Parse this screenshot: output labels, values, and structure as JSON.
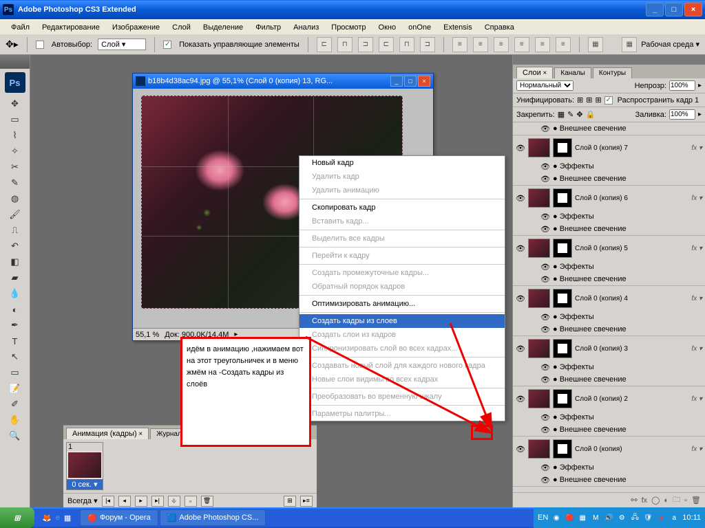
{
  "app": {
    "title": "Adobe Photoshop CS3 Extended"
  },
  "menu": [
    "Файл",
    "Редактирование",
    "Изображение",
    "Слой",
    "Выделение",
    "Фильтр",
    "Анализ",
    "Просмотр",
    "Окно",
    "onOne",
    "Extensis",
    "Справка"
  ],
  "options": {
    "autoselect": "Автовыбор:",
    "autoselect_val": "Слой",
    "show_controls": "Показать управляющие элементы",
    "workspace_label": "Рабочая среда"
  },
  "doc": {
    "title": "b18b4d38ac94.jpg @ 55,1% (Слой 0 (копия) 13, RG...",
    "zoom": "55,1 %",
    "status": "Док: 900,0K/14,4M"
  },
  "context_menu": [
    {
      "t": "Новый кадр",
      "d": false
    },
    {
      "t": "Удалить кадр",
      "d": true
    },
    {
      "t": "Удалить анимацию",
      "d": true
    },
    {
      "sep": true
    },
    {
      "t": "Скопировать кадр",
      "d": false
    },
    {
      "t": "Вставить кадр...",
      "d": true
    },
    {
      "sep": true
    },
    {
      "t": "Выделить все кадры",
      "d": true
    },
    {
      "sep": true
    },
    {
      "t": "Перейти к кадру",
      "d": true
    },
    {
      "sep": true
    },
    {
      "t": "Создать промежуточные кадры...",
      "d": true
    },
    {
      "t": "Обратный порядок кадров",
      "d": true
    },
    {
      "sep": true
    },
    {
      "t": "Оптимизировать анимацию...",
      "d": false
    },
    {
      "sep": true
    },
    {
      "t": "Создать кадры из слоев",
      "d": false,
      "sel": true
    },
    {
      "t": "Создать слои из кадров",
      "d": true
    },
    {
      "t": "Синхронизировать слой во всех кадрах...",
      "d": true
    },
    {
      "sep": true
    },
    {
      "t": "Создавать новый слой для каждого нового кадра",
      "d": true
    },
    {
      "t": "Новые слои видимы во всех кадрах",
      "d": true
    },
    {
      "sep": true
    },
    {
      "t": "Преобразовать во временную шкалу",
      "d": true
    },
    {
      "sep": true
    },
    {
      "t": "Параметры палитры...",
      "d": true
    }
  ],
  "annotation": "идём в анимацию ,нажимаем вот на этот треугольничек и в меню жмём на -Создать кадры из слоёв",
  "layers_panel": {
    "tabs": [
      "Слои",
      "Каналы",
      "Контуры"
    ],
    "blend": "Нормальный",
    "opacity_label": "Непрозр:",
    "opacity": "100%",
    "unify": "Унифицировать:",
    "propagate": "Распространить кадр 1",
    "lock": "Закрепить:",
    "fill_label": "Заливка:",
    "fill": "100%",
    "layers": [
      {
        "name": "Слой 0 (копия) 7",
        "fx": true
      },
      {
        "name": "Слой 0 (копия) 6",
        "fx": true
      },
      {
        "name": "Слой 0 (копия) 5",
        "fx": true
      },
      {
        "name": "Слой 0 (копия) 4",
        "fx": true
      },
      {
        "name": "Слой 0 (копия) 3",
        "fx": true
      },
      {
        "name": "Слой 0 (копия) 2",
        "fx": true
      },
      {
        "name": "Слой 0 (копия)",
        "fx": true
      }
    ],
    "effects": "Эффекты",
    "outer_glow": "Внешнее свечение"
  },
  "anim": {
    "tabs": [
      "Анимация (кадры)",
      "Журнал измер"
    ],
    "frame_num": "1",
    "frame_dur": "0 сек.",
    "loop": "Всегда"
  },
  "taskbar": {
    "items": [
      "Форум - Opera",
      "Adobe Photoshop CS..."
    ],
    "lang": "EN",
    "time": "10:11"
  }
}
